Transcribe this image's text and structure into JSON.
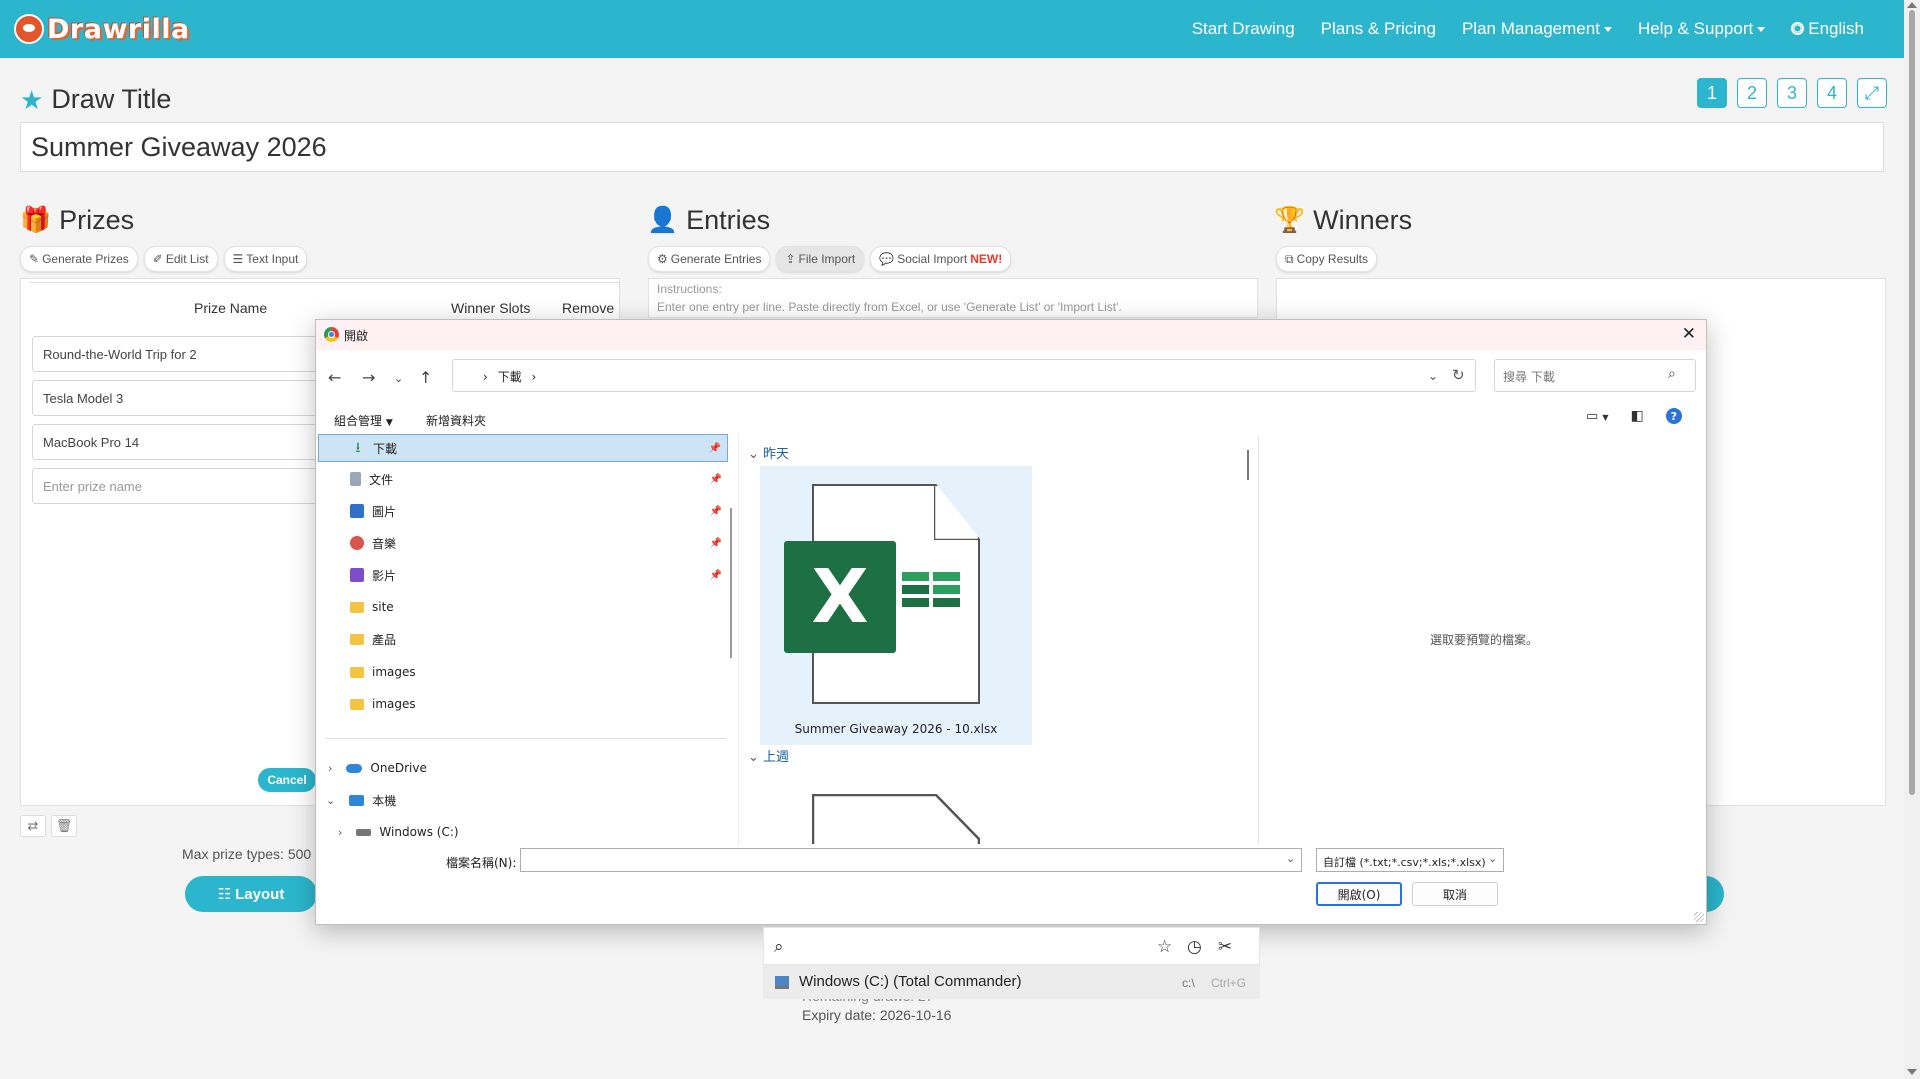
{
  "app": {
    "logo_text": "Drawrilla",
    "nav": {
      "start_drawing": "Start Drawing",
      "plans_pricing": "Plans & Pricing",
      "plan_management": "Plan Management",
      "help_support": "Help & Support",
      "language": "English"
    }
  },
  "draw": {
    "title_heading": "Draw Title",
    "title_value": "Summer Giveaway 2026",
    "pages": [
      "1",
      "2",
      "3",
      "4"
    ],
    "active_page": "1"
  },
  "prizes": {
    "heading": "Prizes",
    "actions": [
      "Generate Prizes",
      "Edit List",
      "Text Input"
    ],
    "columns": {
      "name": "Prize Name",
      "slots": "Winner Slots",
      "remove": "Remove"
    },
    "items": [
      "Round-the-World Trip for 2",
      "Tesla Model 3",
      "MacBook Pro 14"
    ],
    "new_placeholder": "Enter prize name",
    "cancel_label": "Cancel",
    "max_note": "Max prize types: 500 ·",
    "layout_label": "Layout"
  },
  "entries": {
    "heading": "Entries",
    "actions": [
      "Generate Entries",
      "File Import",
      "Social Import"
    ],
    "new_badge": "NEW!",
    "instructions_label": "Instructions:",
    "instructions_text": "Enter one entry per line. Paste directly from Excel, or use 'Generate List' or 'Import List'."
  },
  "winners": {
    "heading": "Winners",
    "actions": [
      "Copy Results"
    ]
  },
  "footer_info": {
    "remaining": "Remaining draws: 27",
    "expiry": "Expiry date: 2026-10-16"
  },
  "dialog": {
    "title": "開啟",
    "address_path": "下載",
    "search_placeholder": "搜尋 下載",
    "organize": "組合管理",
    "new_folder": "新增資料夾",
    "nav_items": [
      {
        "label": "下載",
        "pinned": true
      },
      {
        "label": "文件",
        "pinned": true
      },
      {
        "label": "圖片",
        "pinned": true
      },
      {
        "label": "音樂",
        "pinned": true
      },
      {
        "label": "影片",
        "pinned": true
      },
      {
        "label": "site",
        "pinned": false
      },
      {
        "label": "產品",
        "pinned": false
      },
      {
        "label": "images",
        "pinned": false
      },
      {
        "label": "images",
        "pinned": false
      }
    ],
    "tree": [
      {
        "label": "OneDrive"
      },
      {
        "label": "本機"
      },
      {
        "label": "Windows (C:)"
      }
    ],
    "groups": {
      "yesterday": "昨天",
      "last_week": "上週"
    },
    "file_name": "Summer Giveaway 2026 - 10.xlsx",
    "preview_text": "選取要預覽的檔案。",
    "filename_label": "檔案名稱(N):",
    "filetype_value": "自訂檔 (*.txt;*.csv;*.xls;*.xlsx)",
    "open_label": "開啟(O)",
    "cancel_label": "取消"
  },
  "quickbar": {
    "item_label": "Windows (C:) (Total Commander)",
    "item_path": "c:\\",
    "item_shortcut": "Ctrl+G"
  },
  "colors": {
    "accent": "#2bb6cd",
    "excel_green": "#1d7043",
    "selection": "#cde4f7"
  }
}
